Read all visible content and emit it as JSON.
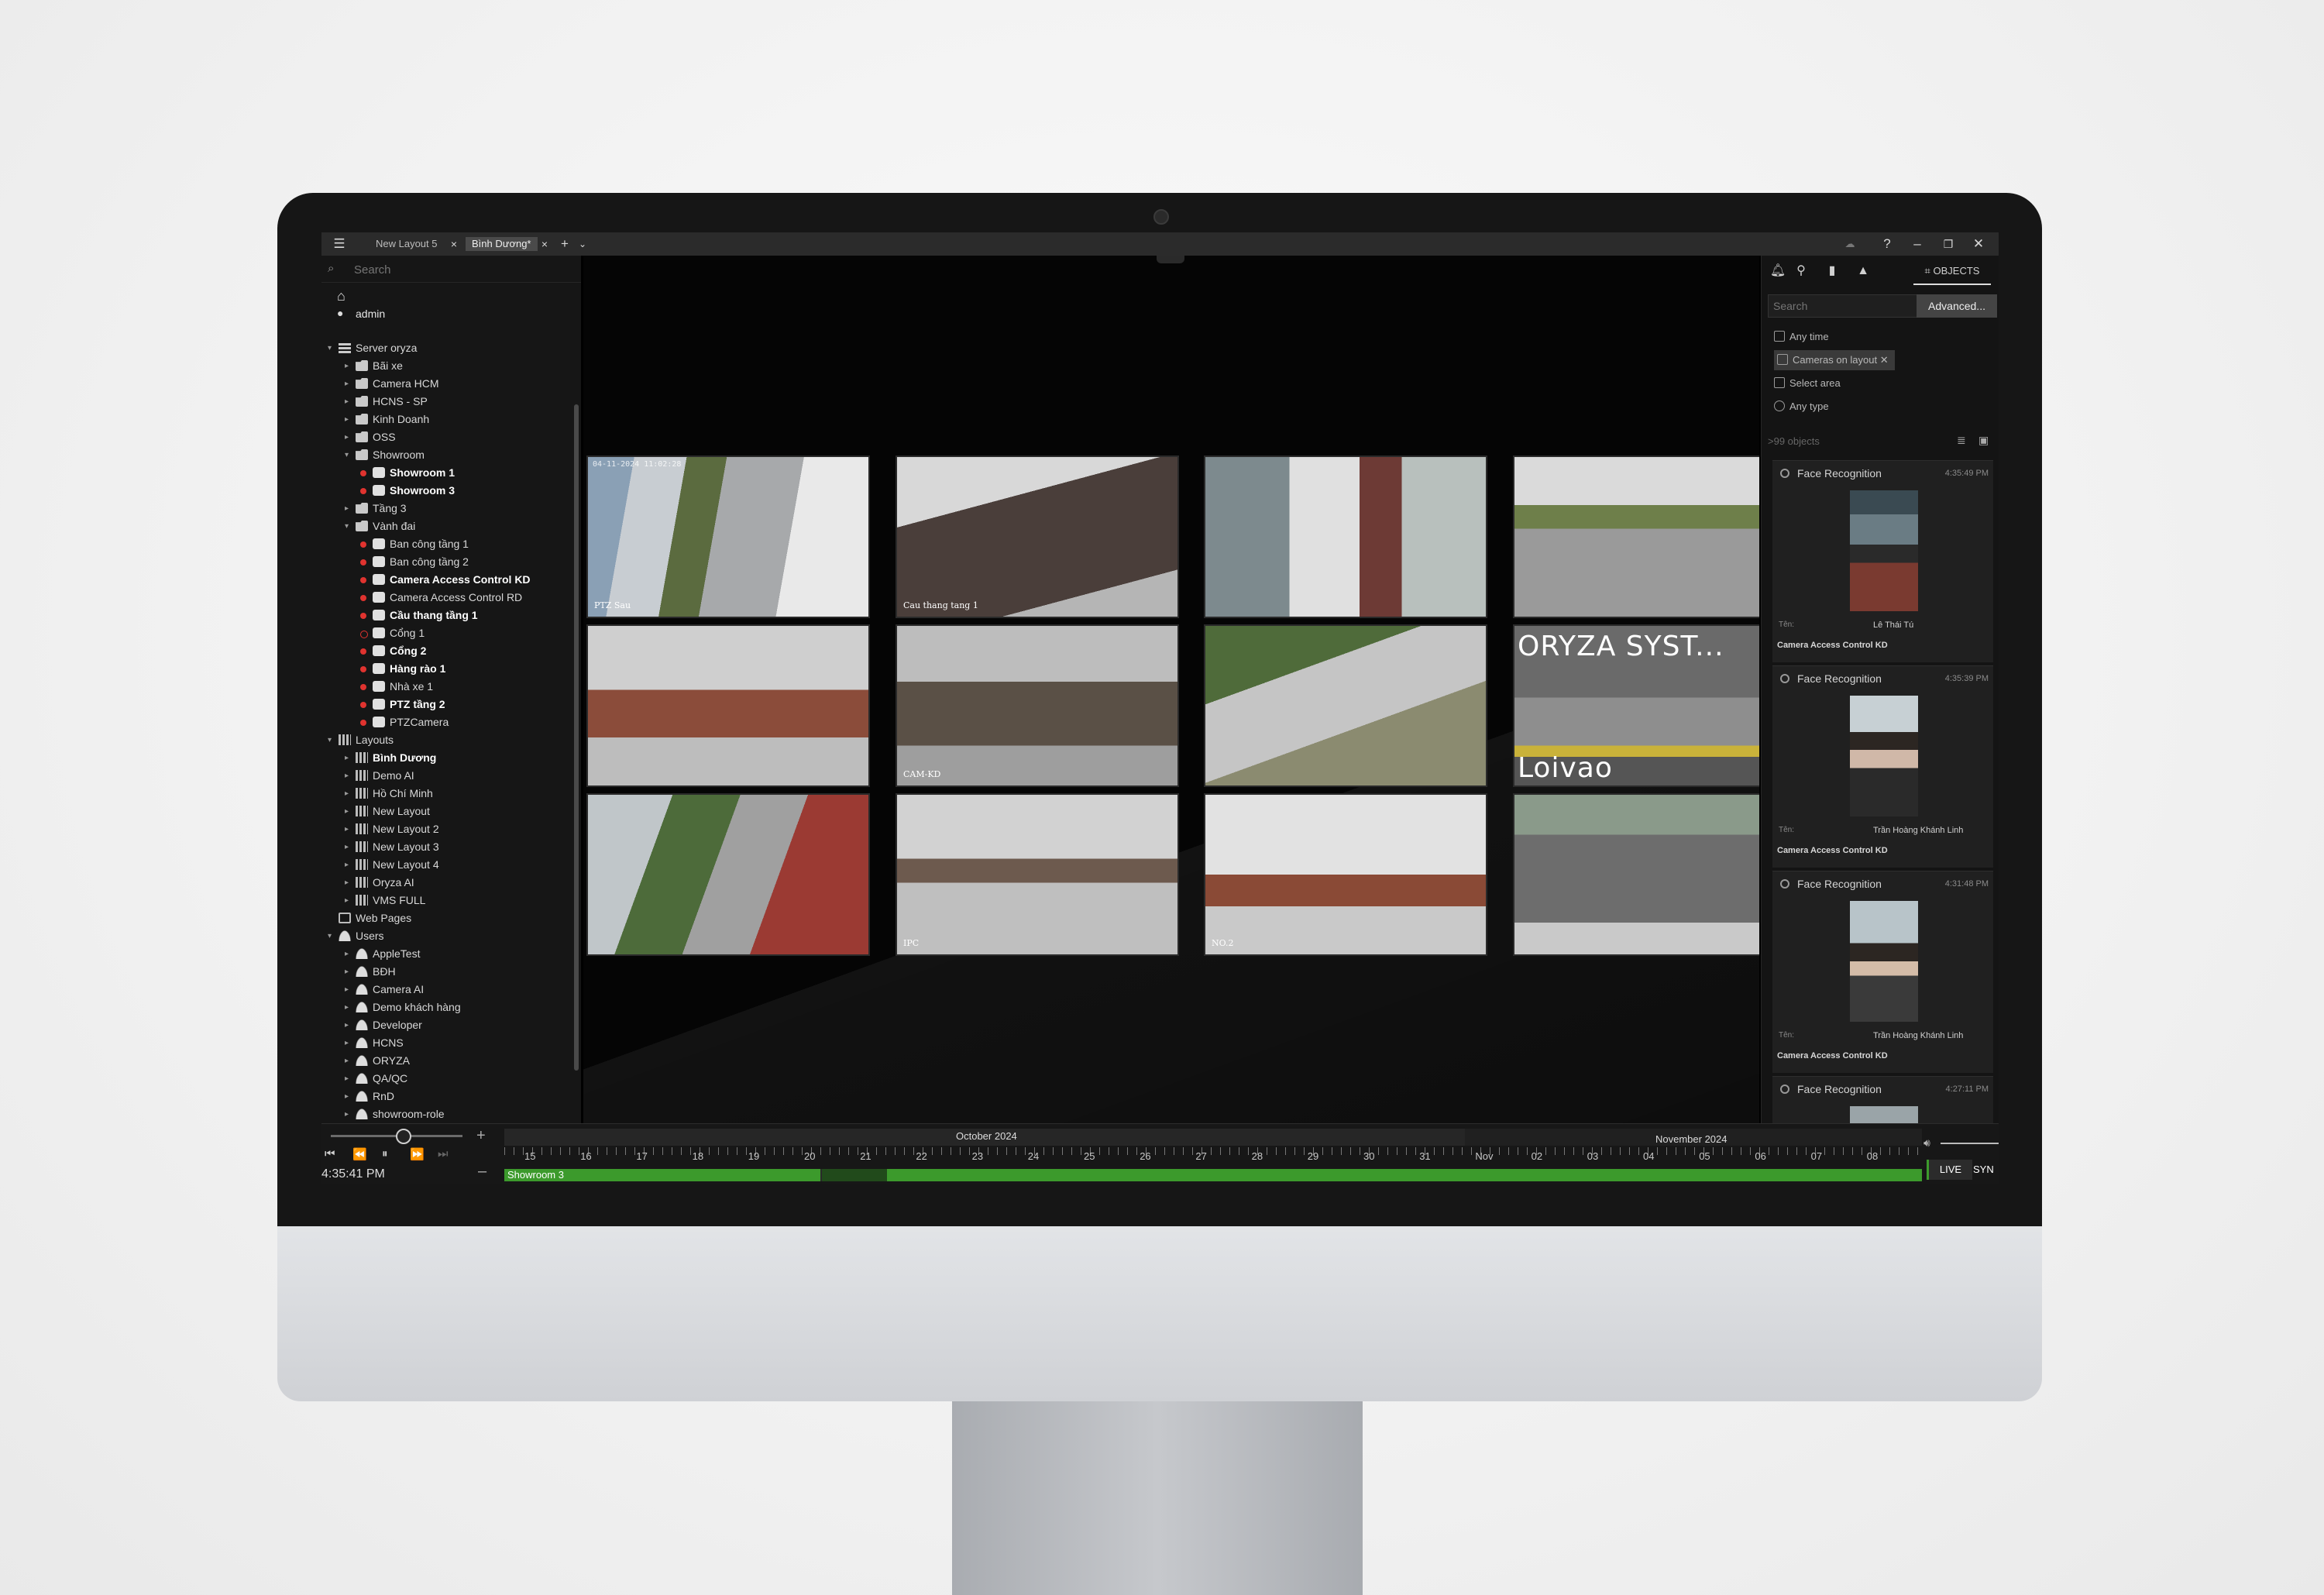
{
  "tabs": [
    {
      "label": "New Layout 5"
    },
    {
      "label": "Bình Dương*"
    }
  ],
  "search": {
    "placeholder": "Search"
  },
  "user": {
    "name": "admin"
  },
  "tree": [
    {
      "label": "Server oryza",
      "level": 0,
      "arrow": "▾",
      "icon": "server"
    },
    {
      "label": "Bãi xe",
      "level": 1,
      "arrow": "▸",
      "icon": "folder"
    },
    {
      "label": "Camera HCM",
      "level": 1,
      "arrow": "▸",
      "icon": "folder"
    },
    {
      "label": "HCNS - SP",
      "level": 1,
      "arrow": "▸",
      "icon": "folder"
    },
    {
      "label": "Kinh Doanh",
      "level": 1,
      "arrow": "▸",
      "icon": "folder"
    },
    {
      "label": "OSS",
      "level": 1,
      "arrow": "▸",
      "icon": "folder"
    },
    {
      "label": "Showroom",
      "level": 1,
      "arrow": "▾",
      "icon": "folder"
    },
    {
      "label": "Showroom 1",
      "level": 2,
      "icon": "cam",
      "dot": "red",
      "bold": true
    },
    {
      "label": "Showroom 3",
      "level": 2,
      "icon": "cam",
      "dot": "red",
      "bold": true
    },
    {
      "label": "Tầng 3",
      "level": 1,
      "arrow": "▸",
      "icon": "folder"
    },
    {
      "label": "Vành đai",
      "level": 1,
      "arrow": "▾",
      "icon": "folder"
    },
    {
      "label": "Ban công tầng 1",
      "level": 2,
      "icon": "cam",
      "dot": "red"
    },
    {
      "label": "Ban công tầng 2",
      "level": 2,
      "icon": "cam",
      "dot": "red"
    },
    {
      "label": "Camera Access Control KD",
      "level": 2,
      "icon": "cam",
      "dot": "red",
      "bold": true
    },
    {
      "label": "Camera Access Control RD",
      "level": 2,
      "icon": "cam",
      "dot": "red"
    },
    {
      "label": "Cầu thang tầng 1",
      "level": 2,
      "icon": "cam",
      "dot": "red",
      "bold": true
    },
    {
      "label": "Cổng 1",
      "level": 2,
      "icon": "cam",
      "dot": "hollow"
    },
    {
      "label": "Cổng 2",
      "level": 2,
      "icon": "cam",
      "dot": "red",
      "bold": true
    },
    {
      "label": "Hàng rào 1",
      "level": 2,
      "icon": "cam",
      "dot": "red",
      "bold": true
    },
    {
      "label": "Nhà xe 1",
      "level": 2,
      "icon": "cam",
      "dot": "red"
    },
    {
      "label": "PTZ tầng 2",
      "level": 2,
      "icon": "cam",
      "dot": "red",
      "bold": true
    },
    {
      "label": "PTZCamera",
      "level": 2,
      "icon": "cam",
      "dot": "red"
    },
    {
      "label": "Layouts",
      "level": 0,
      "arrow": "▾",
      "icon": "grid"
    },
    {
      "label": "Bình Dương",
      "level": 1,
      "arrow": "▸",
      "icon": "grid",
      "bold": true
    },
    {
      "label": "Demo AI",
      "level": 1,
      "arrow": "▸",
      "icon": "grid"
    },
    {
      "label": "Hồ Chí Minh",
      "level": 1,
      "arrow": "▸",
      "icon": "grid"
    },
    {
      "label": "New Layout",
      "level": 1,
      "arrow": "▸",
      "icon": "grid"
    },
    {
      "label": "New Layout 2",
      "level": 1,
      "arrow": "▸",
      "icon": "grid"
    },
    {
      "label": "New Layout 3",
      "level": 1,
      "arrow": "▸",
      "icon": "grid"
    },
    {
      "label": "New Layout 4",
      "level": 1,
      "arrow": "▸",
      "icon": "grid"
    },
    {
      "label": "Oryza AI",
      "level": 1,
      "arrow": "▸",
      "icon": "grid"
    },
    {
      "label": "VMS FULL",
      "level": 1,
      "arrow": "▸",
      "icon": "grid"
    },
    {
      "label": "Web Pages",
      "level": 0,
      "icon": "web"
    },
    {
      "label": "Users",
      "level": 0,
      "arrow": "▾",
      "icon": "user"
    },
    {
      "label": "AppleTest",
      "level": 1,
      "arrow": "▸",
      "icon": "user"
    },
    {
      "label": "BĐH",
      "level": 1,
      "arrow": "▸",
      "icon": "user"
    },
    {
      "label": "Camera AI",
      "level": 1,
      "arrow": "▸",
      "icon": "user"
    },
    {
      "label": "Demo khách hàng",
      "level": 1,
      "arrow": "▸",
      "icon": "user"
    },
    {
      "label": "Developer",
      "level": 1,
      "arrow": "▸",
      "icon": "user"
    },
    {
      "label": "HCNS",
      "level": 1,
      "arrow": "▸",
      "icon": "user"
    },
    {
      "label": "ORYZA",
      "level": 1,
      "arrow": "▸",
      "icon": "user"
    },
    {
      "label": "QA/QC",
      "level": 1,
      "arrow": "▸",
      "icon": "user"
    },
    {
      "label": "RnD",
      "level": 1,
      "arrow": "▸",
      "icon": "user"
    },
    {
      "label": "showroom-role",
      "level": 1,
      "arrow": "▸",
      "icon": "user"
    }
  ],
  "cameras": [
    {
      "stamp": "04-11-2024 11:02:28",
      "label": "PTZ Sau",
      "scene": "street"
    },
    {
      "stamp": "",
      "label": "Cau thang tang 1",
      "scene": "stairs"
    },
    {
      "stamp": "",
      "label": "",
      "scene": "door"
    },
    {
      "stamp": "",
      "label": "",
      "scene": "path"
    },
    {
      "stamp": "",
      "label": "",
      "scene": "room"
    },
    {
      "stamp": "",
      "label": "CAM-KD",
      "scene": "office"
    },
    {
      "stamp": "",
      "label": "",
      "scene": "gate"
    },
    {
      "stamp": "",
      "label": "",
      "scene": "barrier",
      "overlay_top": "ORYZA SYST...",
      "overlay_bottom": "Loivao"
    },
    {
      "stamp": "",
      "label": "",
      "scene": "sidewalk"
    },
    {
      "stamp": "",
      "label": "IPC",
      "scene": "hall"
    },
    {
      "stamp": "",
      "label": "NO.2",
      "scene": "lobby"
    },
    {
      "stamp": "",
      "label": "",
      "scene": "road"
    }
  ],
  "right_panel": {
    "objects_tab": "OBJECTS",
    "search_placeholder": "Search",
    "advanced_button": "Advanced...",
    "filters": [
      "Any time",
      "Cameras on layout",
      "Select area",
      "Any type"
    ],
    "count": ">99 objects",
    "events": [
      {
        "title": "Face Recognition",
        "time": "4:35:49 PM",
        "name_label": "Tên:",
        "name": "Lê Thái Tú",
        "camera": "Camera Access Control KD"
      },
      {
        "title": "Face Recognition",
        "time": "4:35:39 PM",
        "name_label": "Tên:",
        "name": "Trần Hoàng Khánh Linh",
        "camera": "Camera Access Control KD"
      },
      {
        "title": "Face Recognition",
        "time": "4:31:48 PM",
        "name_label": "Tên:",
        "name": "Trần Hoàng Khánh Linh",
        "camera": "Camera Access Control KD"
      },
      {
        "title": "Face Recognition",
        "time": "4:27:11 PM",
        "name_label": "",
        "name": "",
        "camera": ""
      }
    ]
  },
  "timeline": {
    "month1": "October 2024",
    "month2": "November 2024",
    "ticks": [
      "15",
      "16",
      "17",
      "18",
      "19",
      "20",
      "21",
      "22",
      "23",
      "24",
      "25",
      "26",
      "27",
      "28",
      "29",
      "30",
      "31",
      "Nov",
      "02",
      "03",
      "04",
      "05",
      "06",
      "07",
      "08"
    ],
    "track_label": "Showroom 3",
    "clock": "4:35:41 PM",
    "live": "LIVE",
    "sync": "SYN"
  },
  "colors": {
    "accent_green": "#3c9a2c",
    "record_dot": "#e0332f",
    "panel_bg": "#161616"
  }
}
